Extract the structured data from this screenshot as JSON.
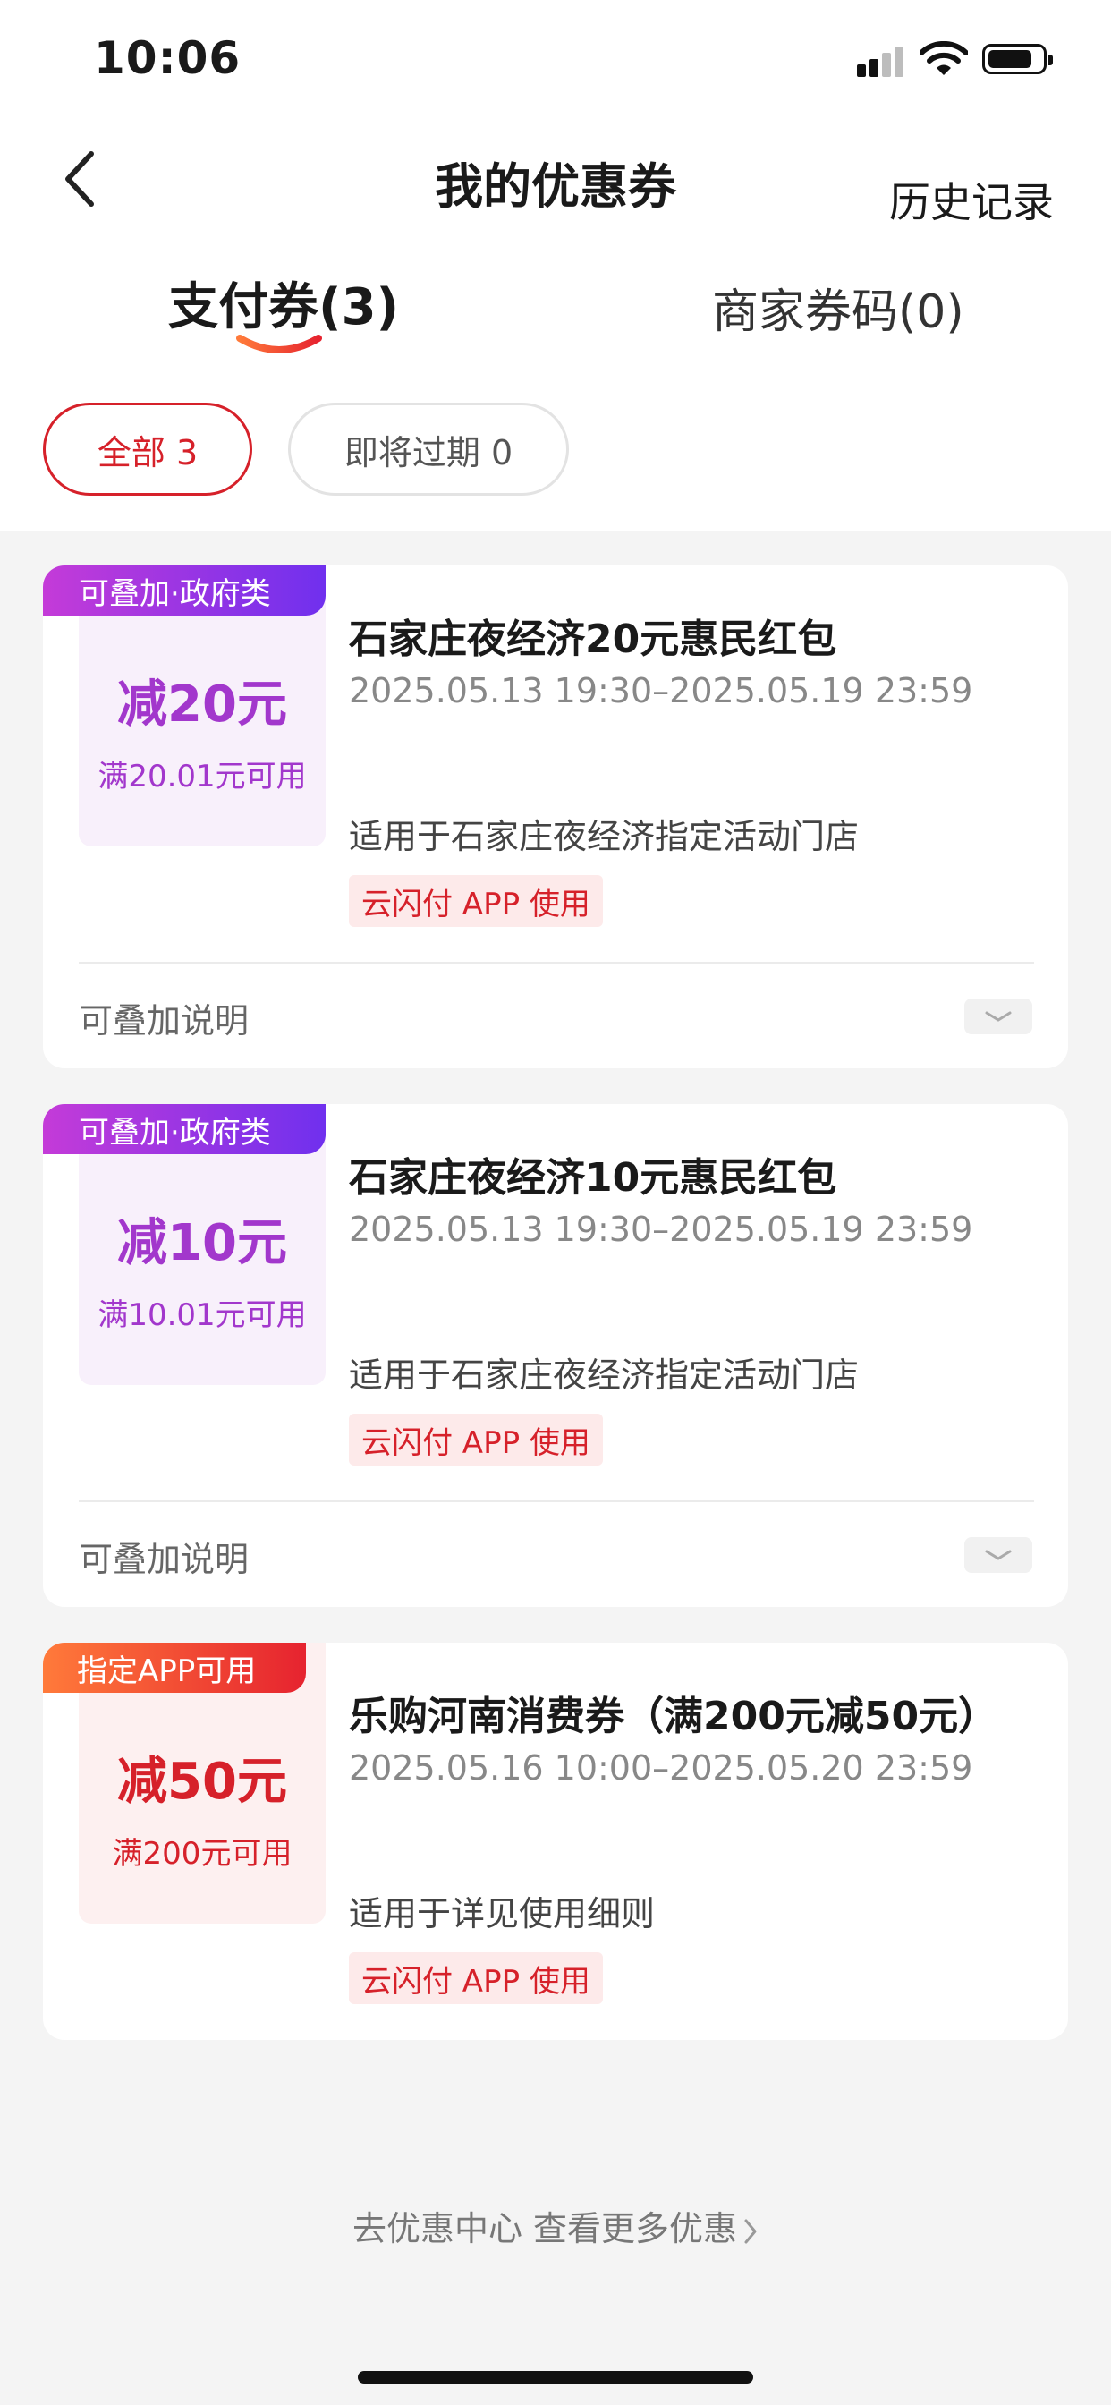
{
  "status_bar": {
    "time": "10:06"
  },
  "nav": {
    "title": "我的优惠券",
    "history_label": "历史记录"
  },
  "tabs": [
    {
      "label": "支付券(3)",
      "active": true
    },
    {
      "label": "商家券码(0)",
      "active": false
    }
  ],
  "filters": [
    {
      "label": "全部 3",
      "selected": true
    },
    {
      "label": "即将过期 0",
      "selected": false
    }
  ],
  "coupons": [
    {
      "tag": "可叠加·政府类",
      "amount": "减20元",
      "condition": "满20.01元可用",
      "name": "石家庄夜经济20元惠民红包",
      "validity": "2025.05.13 19:30–2025.05.19 23:59",
      "scope": "适用于石家庄夜经济指定活动门店",
      "channel": "云闪付 APP 使用",
      "note": "可叠加说明"
    },
    {
      "tag": "可叠加·政府类",
      "amount": "减10元",
      "condition": "满10.01元可用",
      "name": "石家庄夜经济10元惠民红包",
      "validity": "2025.05.13 19:30–2025.05.19 23:59",
      "scope": "适用于石家庄夜经济指定活动门店",
      "channel": "云闪付 APP 使用",
      "note": "可叠加说明"
    },
    {
      "tag": "指定APP可用",
      "amount": "减50元",
      "condition": "满200元可用",
      "name": "乐购河南消费券（满200元减50元）",
      "validity": "2025.05.16 10:00–2025.05.20 23:59",
      "scope": "适用于详见使用细则",
      "channel": "云闪付 APP 使用"
    }
  ],
  "footer": {
    "link_text": "去优惠中心 查看更多优惠"
  },
  "colors": {
    "accent_red": "#d6212a",
    "accent_purple": "#a237cc",
    "page_bg": "#f4f4f4"
  }
}
